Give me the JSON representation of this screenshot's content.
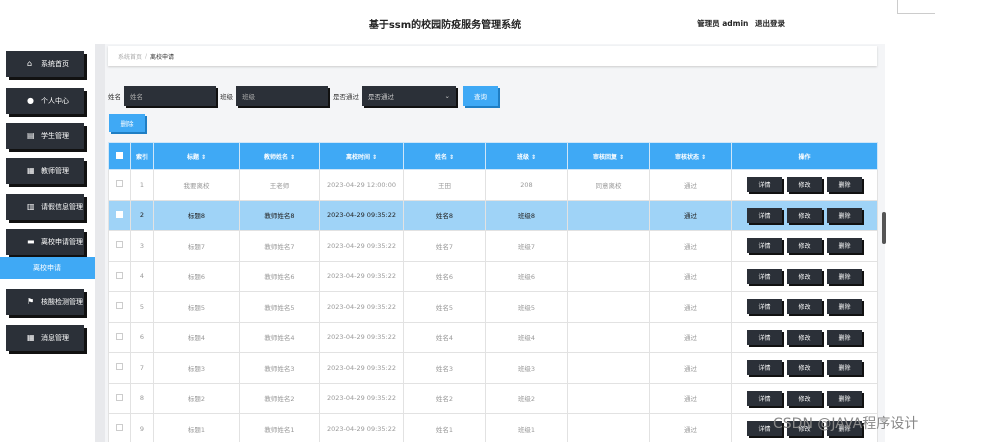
{
  "header": {
    "title": "基于ssm的校园防疫服务管理系统",
    "user_role": "管理员 admin",
    "logout": "退出登录"
  },
  "sidebar": {
    "items": [
      {
        "label": "系统首页",
        "icon": "home-icon"
      },
      {
        "label": "个人中心",
        "icon": "person-icon"
      },
      {
        "label": "学生管理",
        "icon": "list-icon"
      },
      {
        "label": "教师管理",
        "icon": "grid-icon"
      },
      {
        "label": "请假信息管理",
        "icon": "bank-icon"
      },
      {
        "label": "离校申请管理",
        "icon": "card-icon"
      },
      {
        "label": "核酸检测管理",
        "icon": "flag-icon"
      },
      {
        "label": "消息管理",
        "icon": "grid-icon"
      }
    ],
    "active_sub": "离校申请"
  },
  "breadcrumb": {
    "home": "系统首页",
    "separator": "/",
    "current": "离校申请"
  },
  "search": {
    "name_label": "姓名",
    "name_placeholder": "姓名",
    "class_label": "班级",
    "class_placeholder": "班级",
    "approved_label": "是否通过",
    "approved_value": "是否通过",
    "query_button": "查询"
  },
  "actions": {
    "delete_button": "删除"
  },
  "table": {
    "headers": [
      "索引",
      "标题 ⇕",
      "教师姓名 ⇕",
      "离校时间 ⇕",
      "姓名 ⇕",
      "班级 ⇕",
      "审核回复 ⇕",
      "审核状态 ⇕",
      "操作"
    ],
    "op_labels": {
      "detail": "详情",
      "edit": "修改",
      "delete": "删除"
    },
    "rows": [
      {
        "index": "1",
        "title": "我要离校",
        "teacher": "王老师",
        "time": "2023-04-29 12:00:00",
        "name": "王田",
        "class": "208",
        "reply": "同意离校",
        "status": "通过"
      },
      {
        "index": "2",
        "title": "标题8",
        "teacher": "教师姓名8",
        "time": "2023-04-29 09:35:22",
        "name": "姓名8",
        "class": "班级8",
        "reply": "",
        "status": "通过",
        "selected": true
      },
      {
        "index": "3",
        "title": "标题7",
        "teacher": "教师姓名7",
        "time": "2023-04-29 09:35:22",
        "name": "姓名7",
        "class": "班级7",
        "reply": "",
        "status": "通过"
      },
      {
        "index": "4",
        "title": "标题6",
        "teacher": "教师姓名6",
        "time": "2023-04-29 09:35:22",
        "name": "姓名6",
        "class": "班级6",
        "reply": "",
        "status": "通过"
      },
      {
        "index": "5",
        "title": "标题5",
        "teacher": "教师姓名5",
        "time": "2023-04-29 09:35:22",
        "name": "姓名5",
        "class": "班级5",
        "reply": "",
        "status": "通过"
      },
      {
        "index": "6",
        "title": "标题4",
        "teacher": "教师姓名4",
        "time": "2023-04-29 09:35:22",
        "name": "姓名4",
        "class": "班级4",
        "reply": "",
        "status": "通过"
      },
      {
        "index": "7",
        "title": "标题3",
        "teacher": "教师姓名3",
        "time": "2023-04-29 09:35:22",
        "name": "姓名3",
        "class": "班级3",
        "reply": "",
        "status": "通过"
      },
      {
        "index": "8",
        "title": "标题2",
        "teacher": "教师姓名2",
        "time": "2023-04-29 09:35:22",
        "name": "姓名2",
        "class": "班级2",
        "reply": "",
        "status": "通过"
      },
      {
        "index": "9",
        "title": "标题1",
        "teacher": "教师姓名1",
        "time": "2023-04-29 09:35:22",
        "name": "姓名1",
        "class": "班级1",
        "reply": "",
        "status": "通过"
      }
    ]
  },
  "watermark": "CSDN @JAVA程序设计",
  "colors": {
    "accent": "#3fa9f5",
    "dark": "#2b3038",
    "selected_row": "#9fd3f7"
  }
}
